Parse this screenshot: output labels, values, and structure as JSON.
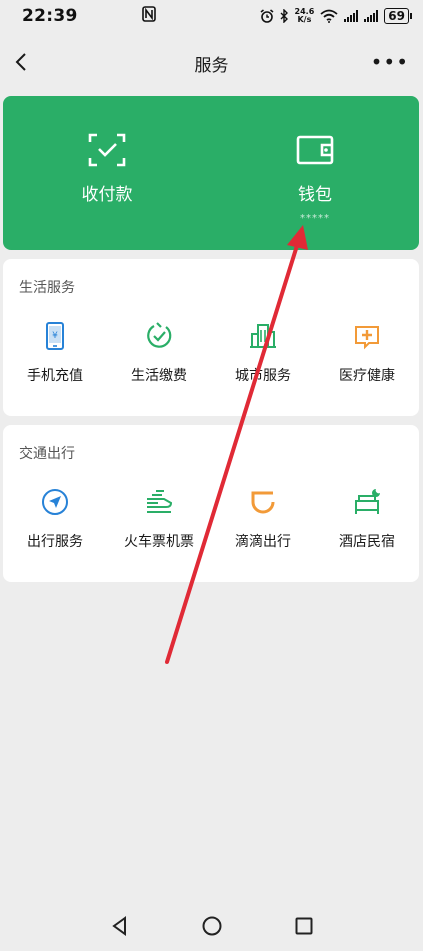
{
  "status_bar": {
    "time": "22:39",
    "net_speed_value": "24.6",
    "net_speed_unit": "K/s",
    "battery": "69"
  },
  "nav": {
    "title": "服务"
  },
  "wallet_card": {
    "items": [
      {
        "label": "收付款",
        "icon": "payment-qr-icon"
      },
      {
        "label": "钱包",
        "icon": "wallet-icon",
        "sub": "*****"
      }
    ],
    "color": "#2aae67"
  },
  "life_services": {
    "title": "生活服务",
    "items": [
      {
        "label": "手机充值",
        "icon": "phone-topup-icon",
        "color": "#2782d7"
      },
      {
        "label": "生活缴费",
        "icon": "utility-payment-icon",
        "color": "#2aae67"
      },
      {
        "label": "城市服务",
        "icon": "city-services-icon",
        "color": "#2aae67"
      },
      {
        "label": "医疗健康",
        "icon": "medical-health-icon",
        "color": "#f29a38"
      }
    ]
  },
  "transport": {
    "title": "交通出行",
    "items": [
      {
        "label": "出行服务",
        "icon": "travel-navigation-icon",
        "color": "#2782d7"
      },
      {
        "label": "火车票机票",
        "icon": "train-ticket-icon",
        "color": "#2aae67"
      },
      {
        "label": "滴滴出行",
        "icon": "didi-icon",
        "color": "#f29a38"
      },
      {
        "label": "酒店民宿",
        "icon": "hotel-bed-icon",
        "color": "#2aae67"
      }
    ]
  },
  "annotation": {
    "color": "#e02a36"
  }
}
